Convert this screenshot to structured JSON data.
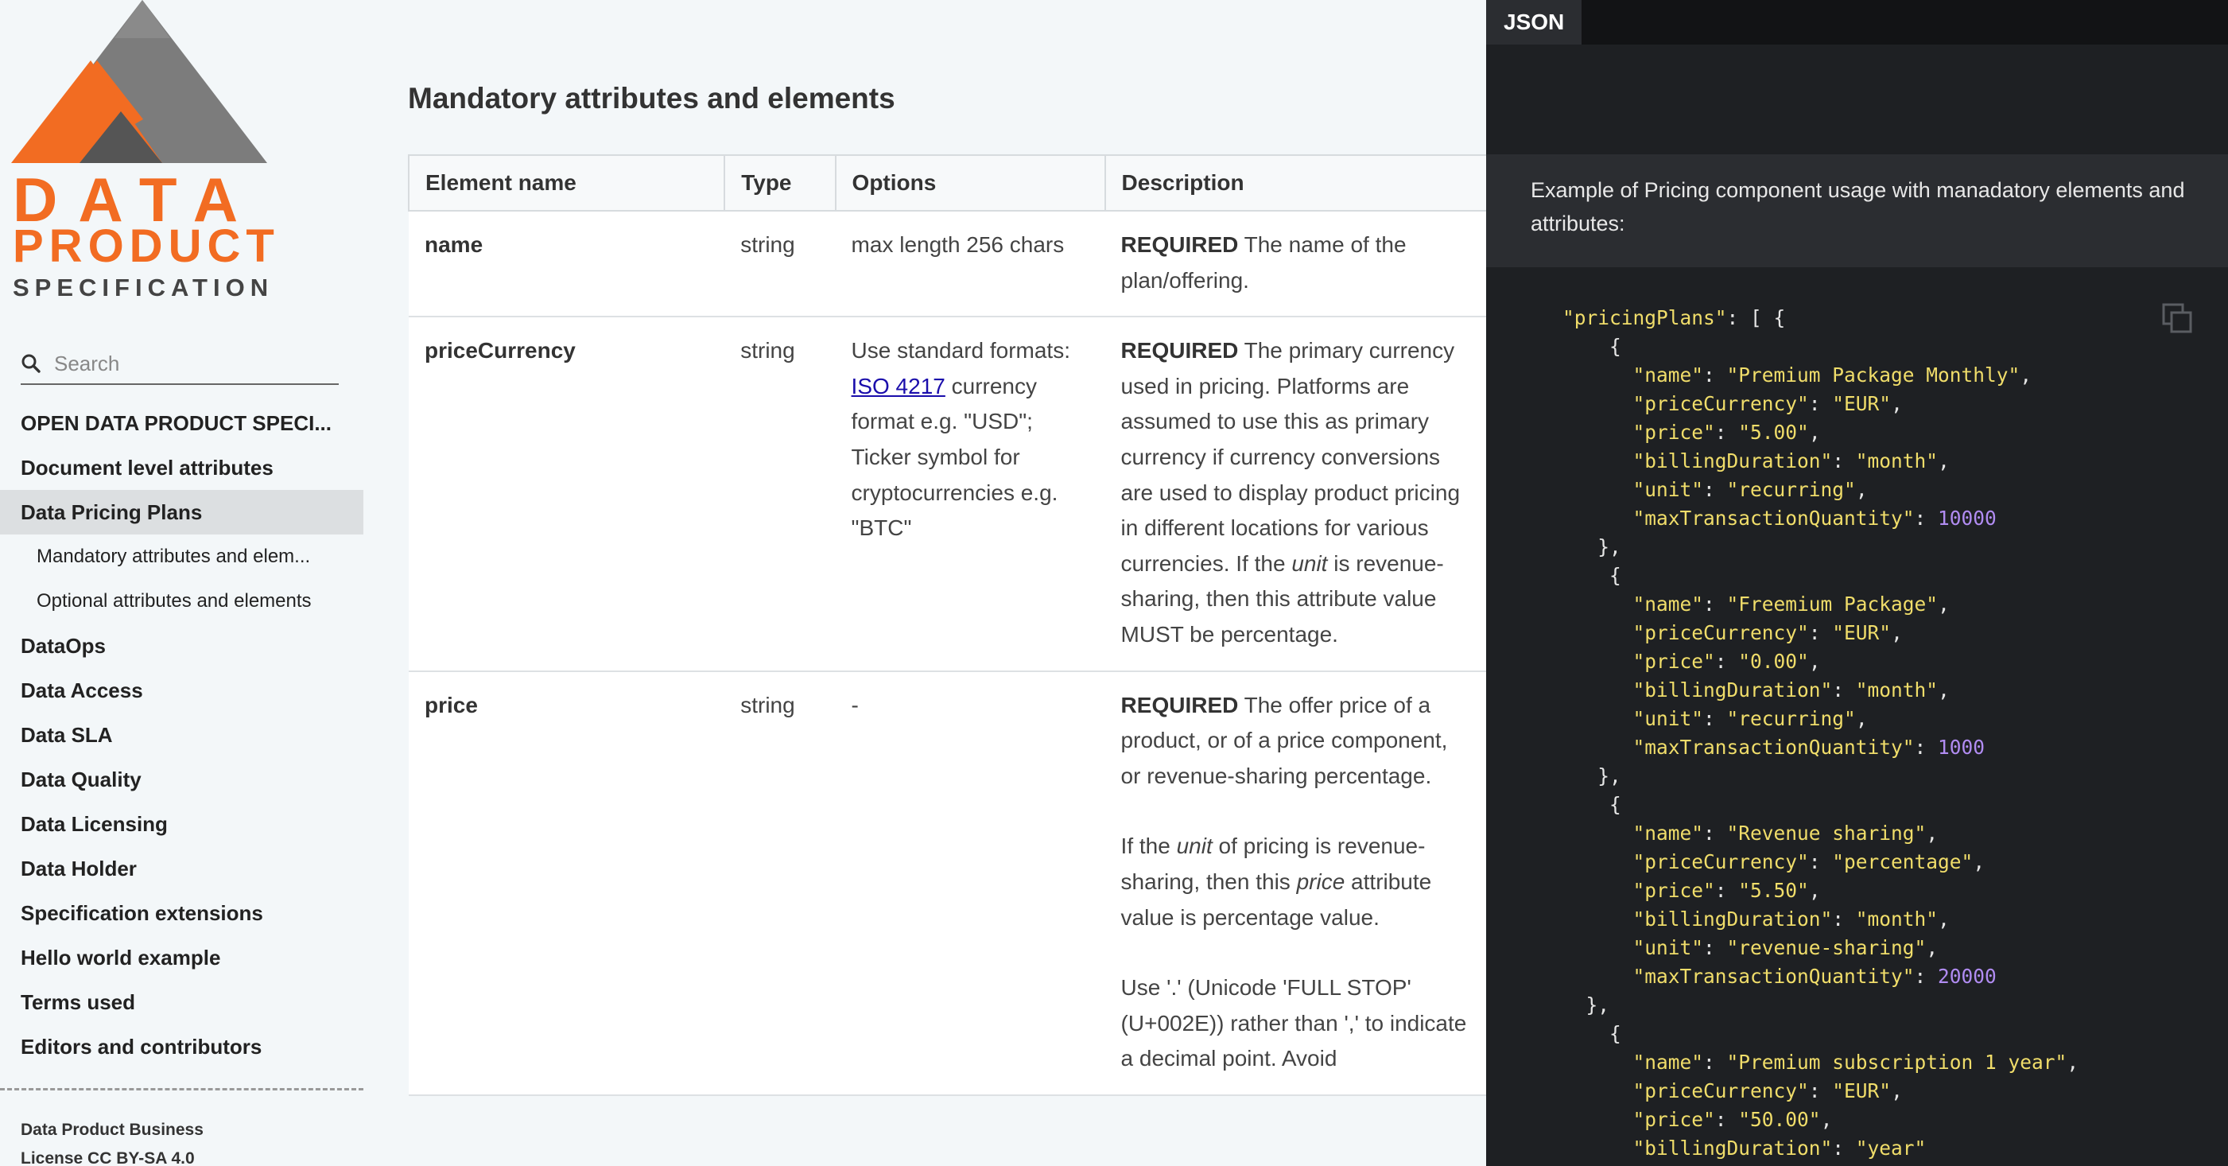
{
  "logo": {
    "line1": "DATA",
    "line2": "PRODUCT",
    "line3": "SPECIFICATION"
  },
  "search": {
    "placeholder": "Search"
  },
  "toc": {
    "items": [
      {
        "label": "OPEN DATA PRODUCT SPECI..."
      },
      {
        "label": "Document level attributes"
      },
      {
        "label": "Data Pricing Plans"
      },
      {
        "label": "Mandatory attributes and elem..."
      },
      {
        "label": "Optional attributes and elements"
      },
      {
        "label": "DataOps"
      },
      {
        "label": "Data Access"
      },
      {
        "label": "Data SLA"
      },
      {
        "label": "Data Quality"
      },
      {
        "label": "Data Licensing"
      },
      {
        "label": "Data Holder"
      },
      {
        "label": "Specification extensions"
      },
      {
        "label": "Hello world example"
      },
      {
        "label": "Terms used"
      },
      {
        "label": "Editors and contributors"
      }
    ],
    "active_index": 2
  },
  "footer": {
    "line1": "Data Product Business",
    "line2": "License CC BY-SA 4.0"
  },
  "main": {
    "heading": "Mandatory attributes and elements",
    "table": {
      "headers": [
        "Element name",
        "Type",
        "Options",
        "Description"
      ],
      "rows": [
        {
          "name": "name",
          "type": "string",
          "options": "max length 256 chars",
          "req": "REQUIRED",
          "desc": " The name of the plan/offering."
        },
        {
          "name": "priceCurrency",
          "type": "string",
          "options_pre": "Use standard formats: ",
          "options_link": "ISO 4217",
          "options_post": " currency format e.g. \"USD\"; Ticker symbol for cryptocurrencies e.g. \"BTC\"",
          "req": "REQUIRED",
          "desc_pre": " The primary currency used in pricing. Platforms are assumed to use this as primary currency if currency conversions are used to display product pricing in different locations for various currencies. If the ",
          "desc_em": "unit",
          "desc_post": " is revenue-sharing, then this attribute value MUST be percentage."
        },
        {
          "name": "price",
          "type": "string",
          "options": "-",
          "req": "REQUIRED",
          "desc": " The offer price of a product, or of a price component, or revenue-sharing percentage.",
          "p2_pre": "If the ",
          "p2_em1": "unit",
          "p2_mid": " of pricing is revenue-sharing, then this ",
          "p2_em2": "price",
          "p2_post": " attribute value is percentage value.",
          "p3": "Use '.' (Unicode 'FULL STOP' (U+002E)) rather than ',' to indicate a decimal point. Avoid"
        }
      ]
    }
  },
  "json_panel": {
    "tab": "JSON",
    "intro": "Example of Pricing component usage with manadatory elements and attributes:",
    "plans": [
      {
        "name": "Premium Package Monthly",
        "priceCurrency": "EUR",
        "price": "5.00",
        "billingDuration": "month",
        "unit": "recurring",
        "maxTransactionQuantity": "10000"
      },
      {
        "name": "Freemium Package",
        "priceCurrency": "EUR",
        "price": "0.00",
        "billingDuration": "month",
        "unit": "recurring",
        "maxTransactionQuantity": "1000"
      },
      {
        "name": "Revenue sharing",
        "priceCurrency": "percentage",
        "price": "5.50",
        "billingDuration": "month",
        "unit": "revenue-sharing",
        "maxTransactionQuantity": "20000"
      },
      {
        "name": "Premium subscription 1 year",
        "priceCurrency": "EUR",
        "price": "50.00",
        "billingDuration": "year"
      }
    ]
  },
  "colors": {
    "brand_orange": "#f26c22",
    "brand_gray": "#7a7a7a",
    "code_bg": "#1e2023",
    "code_string": "#f0dd6a",
    "code_number": "#b18cf2"
  }
}
